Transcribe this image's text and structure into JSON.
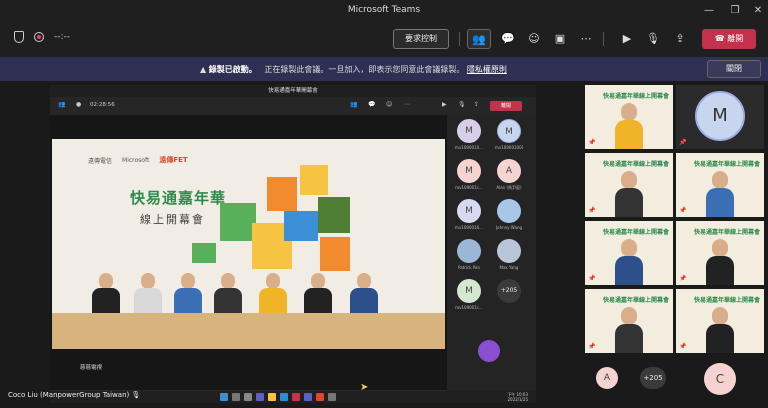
{
  "window": {
    "title": "Microsoft Teams"
  },
  "toolbar": {
    "timer": "--:--",
    "request_control_label": "要求控制",
    "leave_label": "離開",
    "colors": {
      "leave": "#c4314b"
    }
  },
  "banner": {
    "recording_label": "錄製已啟動。",
    "message": "正在錄製此會議。一旦加入，即表示您同意此會議錄製。",
    "privacy_link": "隱私權原則",
    "close_label": "關閉"
  },
  "shared_screen": {
    "window_title": "快易通嘉年華開幕會",
    "timer": "02:28:56",
    "leave_label": "離開",
    "slide": {
      "logo_1": "遠傳電信",
      "logo_2": "Microsoft",
      "logo_3": "遠傳FET",
      "title": "快易通嘉年華",
      "subtitle": "線上開幕會"
    },
    "caption": "慈慈電視",
    "roster": [
      {
        "initial": "M",
        "name": "mv1090010..."
      },
      {
        "initial": "M",
        "name": "mv1090010008"
      },
      {
        "initial": "M",
        "name": "mv109001c..."
      },
      {
        "initial": "A",
        "name": "Alan (馬尹庭)"
      },
      {
        "initial": "M",
        "name": "mv1090016..."
      },
      {
        "initial": "",
        "name": "Johnny Wang"
      },
      {
        "initial": "",
        "name": "Patrick Pan"
      },
      {
        "initial": "",
        "name": "Max Yang"
      },
      {
        "initial": "M",
        "name": "mv109001c..."
      },
      {
        "initial": "+205",
        "name": ""
      }
    ],
    "taskbar_time": "下午 10:03",
    "taskbar_date": "2022/1/25"
  },
  "self_view": {
    "name": "Coco Liu (ManpowerGroup Taiwan)"
  },
  "gallery": {
    "tile_title": "快易通嘉年華線上開幕會",
    "m_initial": "M",
    "a_initial": "A",
    "overflow_count": "+205",
    "c_initial": "C"
  }
}
